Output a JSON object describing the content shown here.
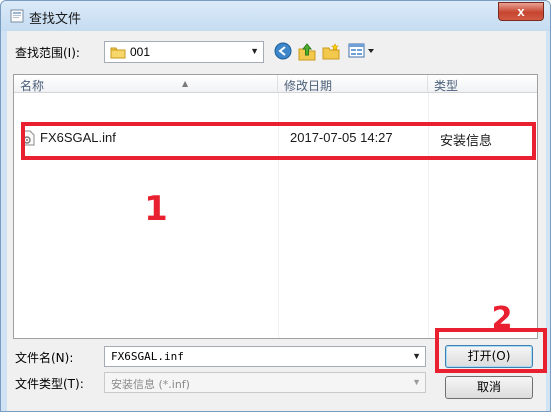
{
  "window": {
    "title": "查找文件",
    "close_glyph": "x"
  },
  "lookin": {
    "label": "查找范围(I):",
    "value": "001"
  },
  "toolbar": {
    "icons": [
      "back-icon",
      "up-folder-icon",
      "new-folder-icon",
      "views-menu-icon"
    ]
  },
  "filelist": {
    "columns": [
      "名称",
      "修改日期",
      "类型"
    ],
    "rows": [
      {
        "name": "FX6SGAL.inf",
        "modified": "2017-07-05 14:27",
        "type": "安装信息"
      }
    ]
  },
  "filename": {
    "label": "文件名(N):",
    "value": "FX6SGAL.inf"
  },
  "filetype": {
    "label": "文件类型(T):",
    "value": "安装信息 (*.inf)"
  },
  "buttons": {
    "open": "打开(O)",
    "cancel": "取消"
  },
  "annotations": {
    "color": "#e8202f",
    "step_1": "1",
    "step_2": "2"
  }
}
